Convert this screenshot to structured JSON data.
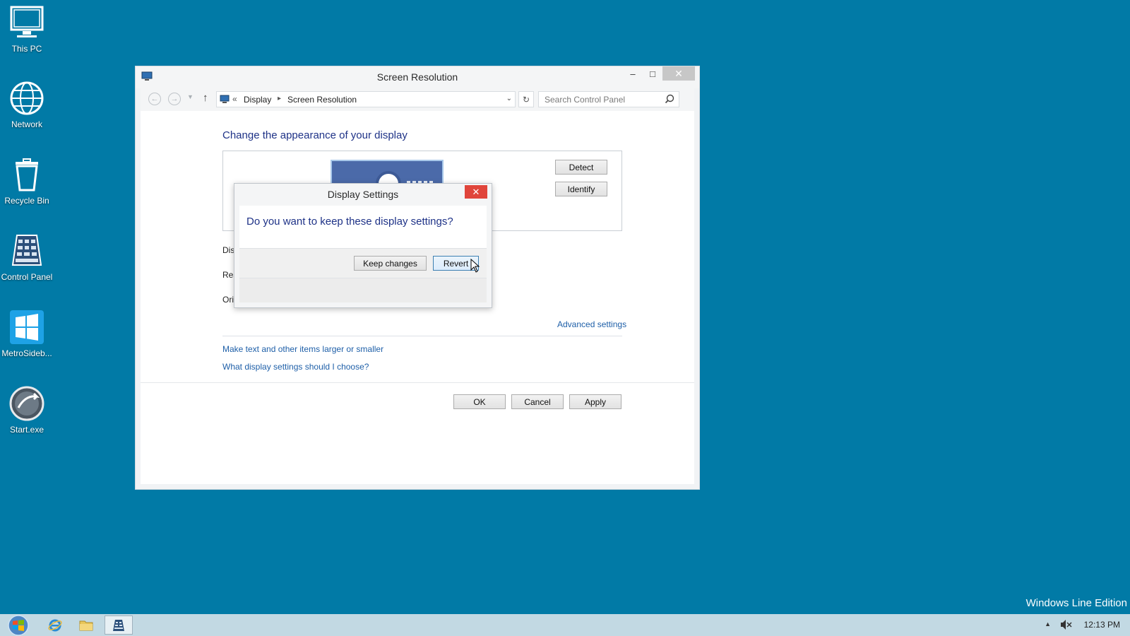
{
  "desktop": {
    "icons": [
      {
        "label": "This PC",
        "icon": "this-pc-icon"
      },
      {
        "label": "Network",
        "icon": "network-globe-icon"
      },
      {
        "label": "Recycle Bin",
        "icon": "recycle-bin-icon"
      },
      {
        "label": "Control Panel",
        "icon": "control-panel-icon"
      },
      {
        "label": "MetroSideb...",
        "icon": "windows-logo-icon"
      },
      {
        "label": "Start.exe",
        "icon": "start-orb-icon"
      }
    ],
    "watermark": "Windows Line Edition",
    "background_color": "#017aa6"
  },
  "window": {
    "title": "Screen Resolution",
    "address": {
      "crumbs": [
        "Display",
        "Screen Resolution"
      ]
    },
    "search": {
      "placeholder": "Search Control Panel"
    },
    "heading": "Change the appearance of your display",
    "detect_label": "Detect",
    "identify_label": "Identify",
    "rows": [
      "Dis",
      "Res",
      "Ori"
    ],
    "advanced_link": "Advanced settings",
    "links": [
      "Make text and other items larger or smaller",
      "What display settings should I choose?"
    ],
    "buttons": {
      "ok": "OK",
      "cancel": "Cancel",
      "apply": "Apply"
    }
  },
  "dialog": {
    "title": "Display Settings",
    "question": "Do you want to keep these display settings?",
    "keep_label": "Keep changes",
    "revert_label": "Revert",
    "close_color": "#e0453b"
  },
  "taskbar": {
    "items": [
      "start-orb-icon",
      "internet-explorer-icon",
      "file-explorer-icon",
      "control-panel-icon"
    ],
    "clock": "12:13 PM"
  }
}
